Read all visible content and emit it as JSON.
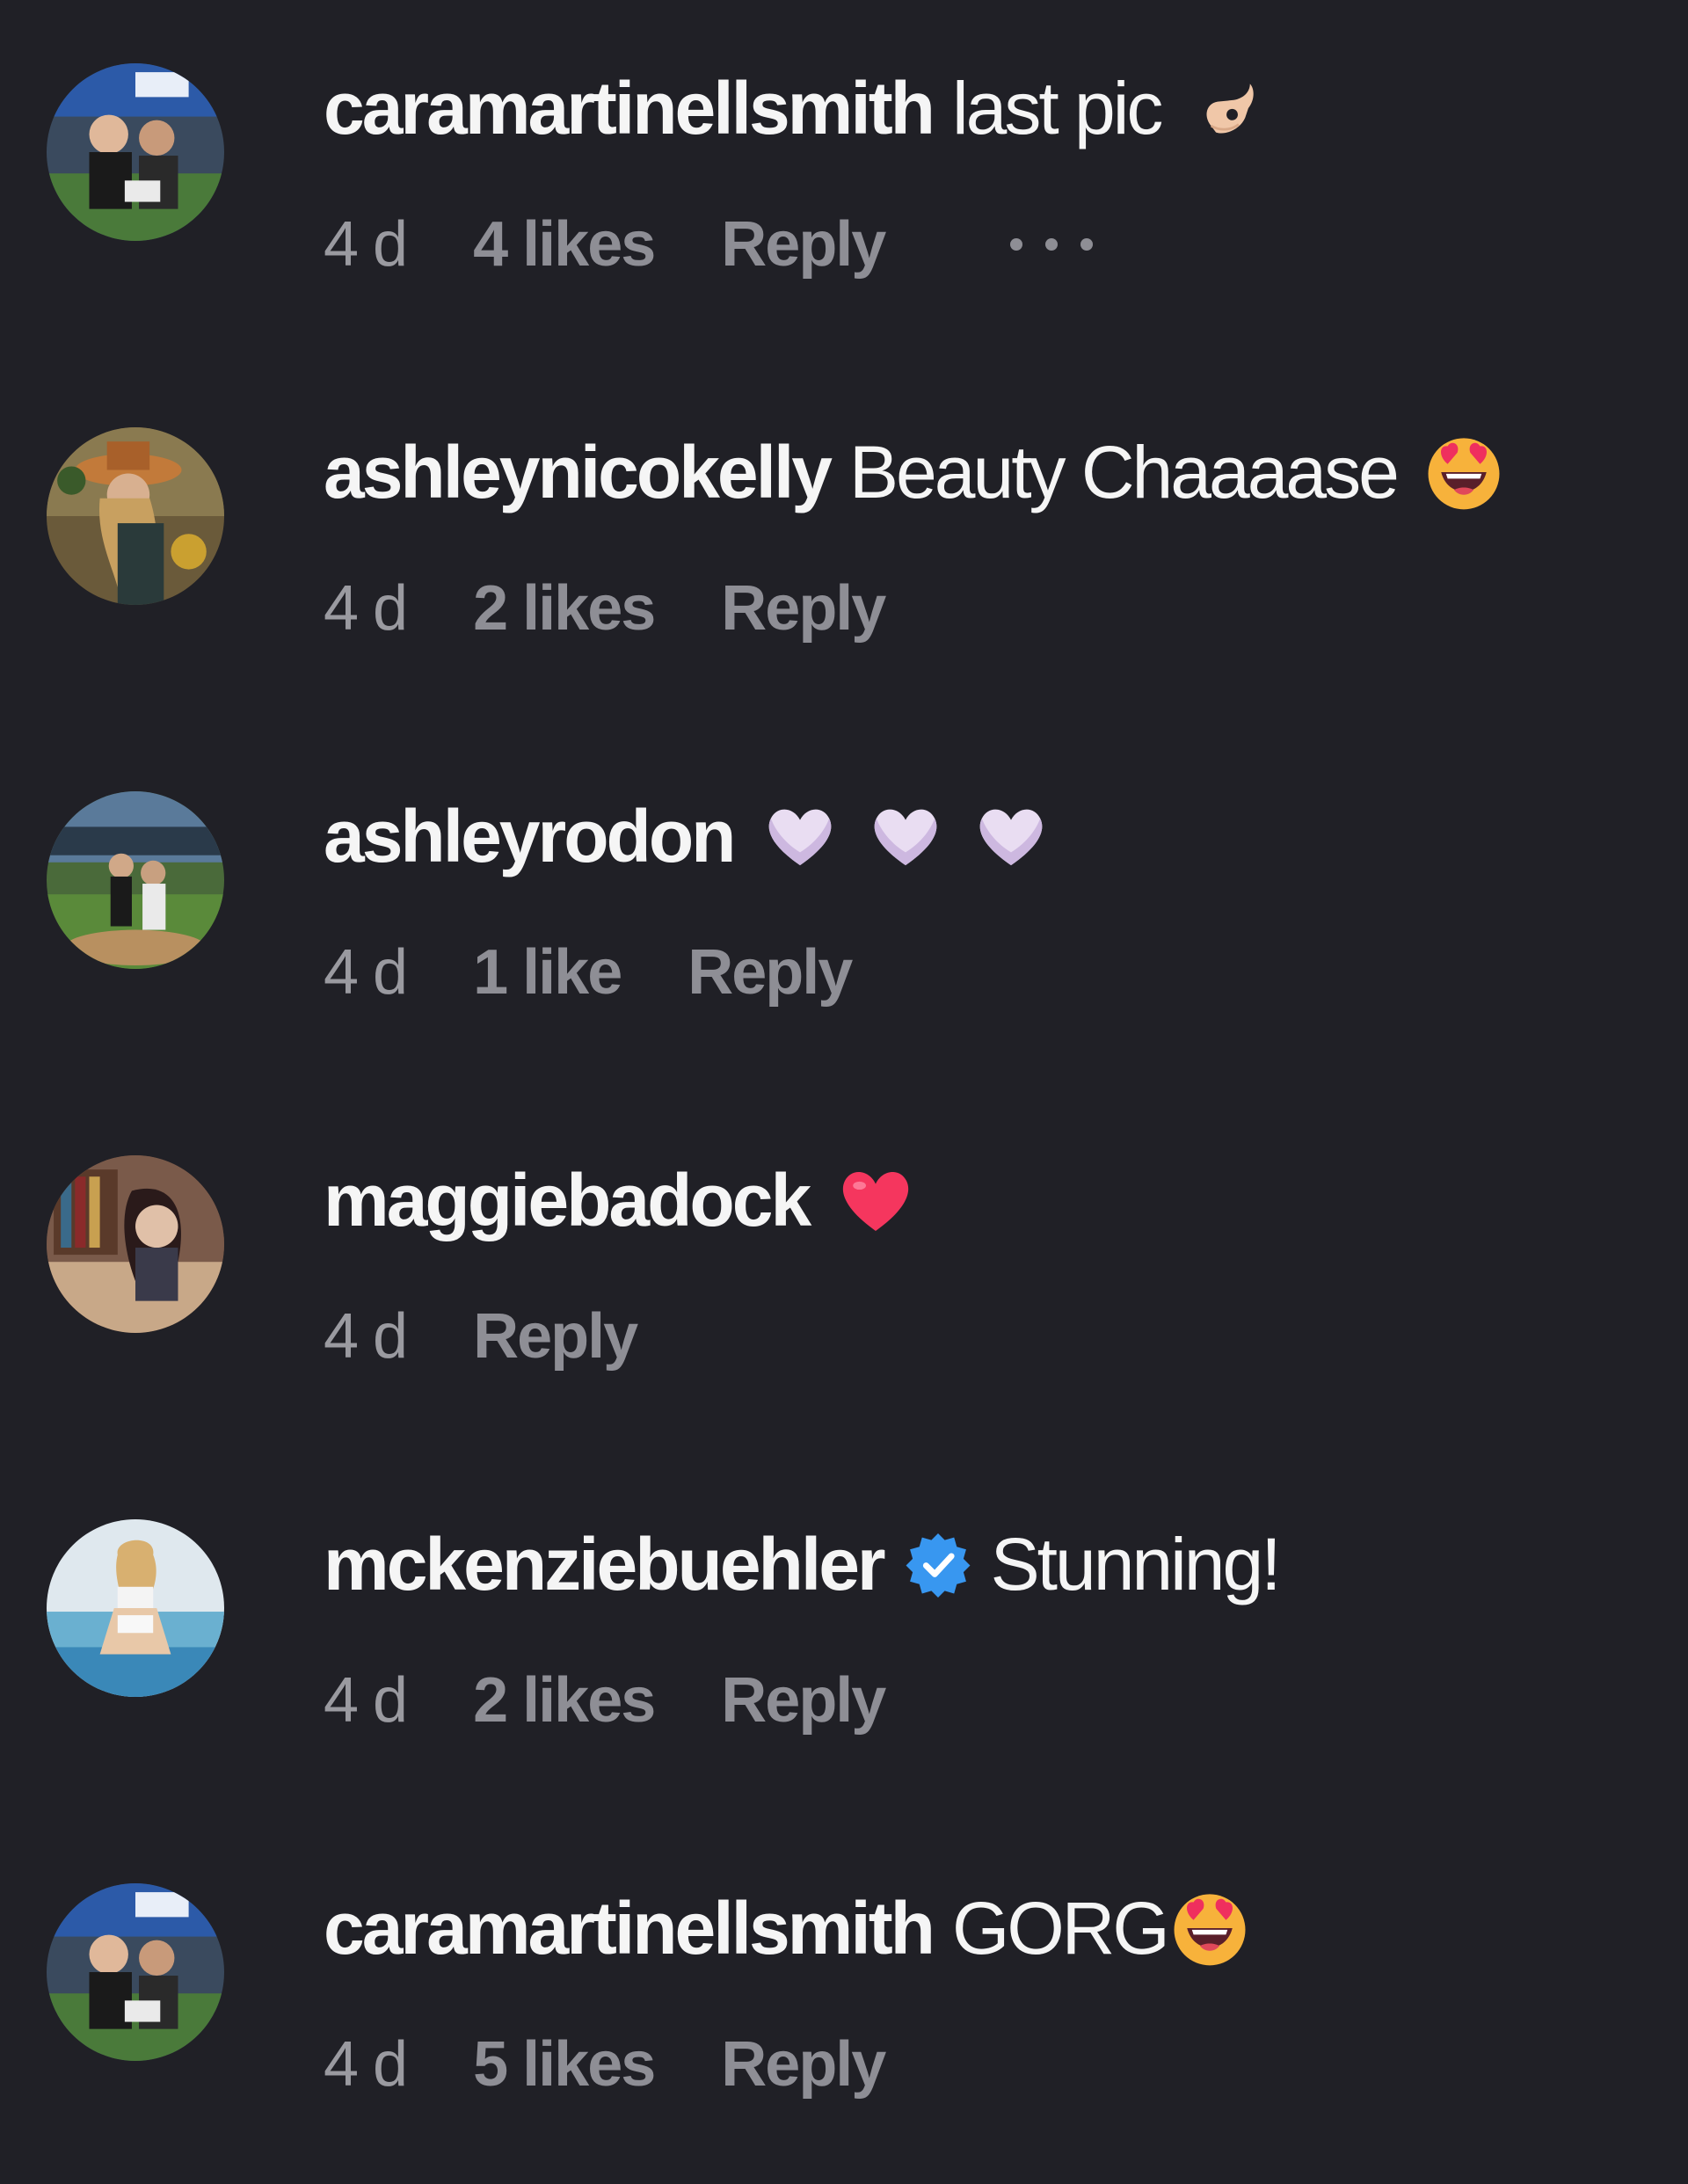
{
  "colors": {
    "background": "#202026",
    "text_primary": "#f5f5f5",
    "text_secondary": "#8e8e95",
    "verified": "#3897f0"
  },
  "comments": [
    {
      "username": "caramartinellsmith",
      "text": "last pic",
      "emoji_icon": "ok-hand-icon",
      "time": "4 d",
      "likes": "4 likes",
      "reply": "Reply",
      "has_more": true
    },
    {
      "username": "ashleynicokelly",
      "text": "Beauty Chaaaase",
      "emoji_icon": "heart-eyes-icon",
      "time": "4 d",
      "likes": "2 likes",
      "reply": "Reply"
    },
    {
      "username": "ashleyrodon",
      "text": "",
      "emoji_icon": "white-heart-icon",
      "emoji_count": 3,
      "time": "4 d",
      "likes": "1 like",
      "reply": "Reply"
    },
    {
      "username": "maggiebadock",
      "text": "",
      "emoji_icon": "red-heart-icon",
      "time": "4 d",
      "likes": "",
      "reply": "Reply"
    },
    {
      "username": "mckenziebuehler",
      "verified": true,
      "text": "Stunning!",
      "time": "4 d",
      "likes": "2 likes",
      "reply": "Reply"
    },
    {
      "username": "caramartinellsmith",
      "text": "GORG",
      "emoji_icon": "heart-eyes-icon",
      "time": "4 d",
      "likes": "5 likes",
      "reply": "Reply"
    }
  ]
}
